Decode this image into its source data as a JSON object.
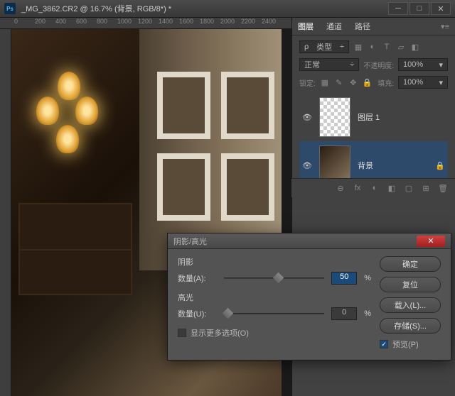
{
  "titlebar": {
    "ps": "Ps",
    "title": "_MG_3862.CR2 @ 16.7% (背景, RGB/8*) *"
  },
  "ruler_h": [
    "0",
    "200",
    "400",
    "600",
    "800",
    "1000",
    "1200",
    "1400",
    "1600",
    "1800",
    "2000",
    "2200",
    "2400"
  ],
  "panel": {
    "tabs": [
      "图层",
      "通道",
      "路径"
    ],
    "kind": "类型",
    "kind_ph": "ρ",
    "blend": "正常",
    "opacity_lbl": "不透明度:",
    "opacity": "100%",
    "lock_lbl": "锁定:",
    "fill_lbl": "填充:",
    "fill": "100%",
    "layers": [
      {
        "name": "图层 1",
        "thumb": "checker",
        "locked": false
      },
      {
        "name": "背景",
        "thumb": "img",
        "locked": true
      }
    ],
    "footer_icons": [
      "⊖",
      "fx",
      "◐",
      "◧",
      "▢",
      "⊞",
      "🗑"
    ]
  },
  "dialog": {
    "title": "阴影/高光",
    "shadows": {
      "title": "阴影",
      "amount_lbl": "数量(A):",
      "amount": "50",
      "pos": 50
    },
    "highlights": {
      "title": "高光",
      "amount_lbl": "数量(U):",
      "amount": "0",
      "pos": 0
    },
    "pct": "%",
    "more": "显示更多选项(O)",
    "preview": "预览(P)",
    "buttons": {
      "ok": "确定",
      "reset": "复位",
      "load": "载入(L)...",
      "save": "存储(S)..."
    }
  }
}
